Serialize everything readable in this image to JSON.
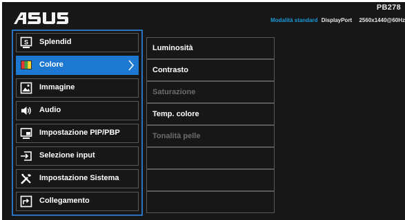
{
  "header": {
    "brand": "ASUS",
    "model": "PB278",
    "mode": "Modalità standard",
    "input": "DisplayPort",
    "resolution": "2560x1440@60Hz"
  },
  "main_menu": {
    "items": [
      {
        "label": "Splendid",
        "icon": "splendid-icon"
      },
      {
        "label": "Colore",
        "icon": "color-icon",
        "selected": true
      },
      {
        "label": "Immagine",
        "icon": "image-icon"
      },
      {
        "label": "Audio",
        "icon": "speaker-icon"
      },
      {
        "label": "Impostazione PIP/PBP",
        "icon": "pip-icon"
      },
      {
        "label": "Selezione input",
        "icon": "input-icon"
      },
      {
        "label": "Impostazione Sistema",
        "icon": "tools-icon"
      },
      {
        "label": "Collegamento",
        "icon": "shortcut-icon"
      }
    ]
  },
  "sub_menu": {
    "items": [
      {
        "label": "Luminosità",
        "enabled": true
      },
      {
        "label": "Contrasto",
        "enabled": true
      },
      {
        "label": "Saturazione",
        "enabled": false
      },
      {
        "label": "Temp. colore",
        "enabled": true
      },
      {
        "label": "Tonalità pelle",
        "enabled": false
      },
      {
        "label": "",
        "enabled": false
      },
      {
        "label": "",
        "enabled": false
      },
      {
        "label": "",
        "enabled": false
      }
    ]
  },
  "colors": {
    "accent": "#1c78d0",
    "mode_text": "#1a9ad7",
    "background": "#171717",
    "disabled_text": "#6c6c6c"
  }
}
